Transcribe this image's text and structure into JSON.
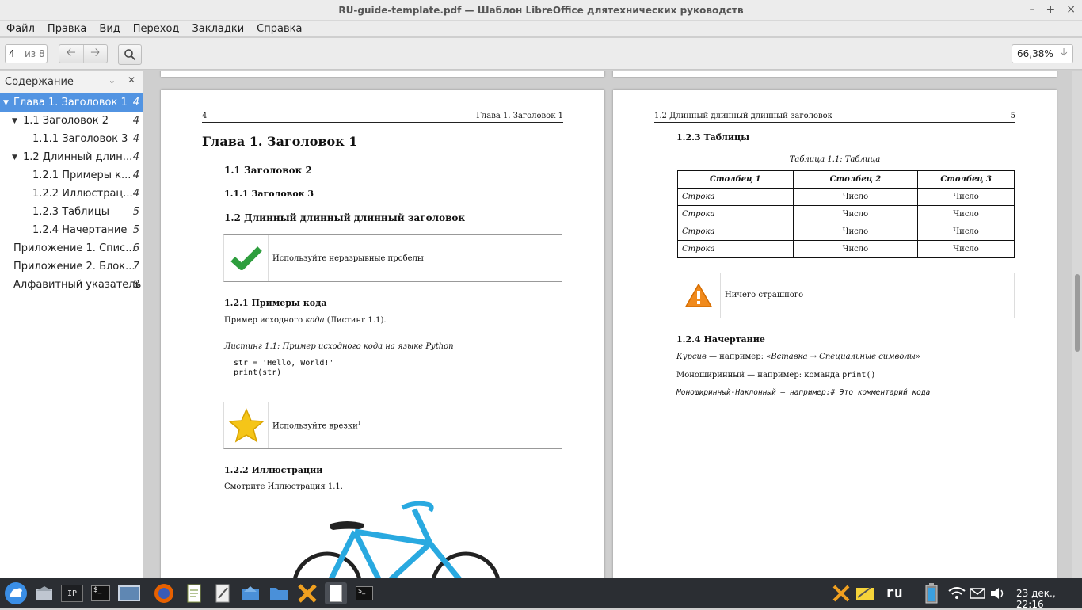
{
  "window": {
    "title": "RU-guide-template.pdf — Шаблон LibreOffice длятехнических руководств",
    "minimize": "–",
    "maximize": "+",
    "close": "×"
  },
  "menu": [
    "Файл",
    "Правка",
    "Вид",
    "Переход",
    "Закладки",
    "Справка"
  ],
  "toolbar": {
    "page_number": "4",
    "page_of": "из 8",
    "zoom": "66,38%"
  },
  "sidebar": {
    "title": "Содержание",
    "items": [
      {
        "label": "Глава 1.  Заголовок 1",
        "page": "4"
      },
      {
        "label": "1.1  Заголовок 2",
        "page": "4"
      },
      {
        "label": "1.1.1  Заголовок 3",
        "page": "4"
      },
      {
        "label": "1.2  Длинный длин...",
        "page": "4"
      },
      {
        "label": "1.2.1  Примеры к...",
        "page": "4"
      },
      {
        "label": "1.2.2  Иллюстрац...",
        "page": "4"
      },
      {
        "label": "1.2.3  Таблицы",
        "page": "5"
      },
      {
        "label": "1.2.4  Начертание",
        "page": "5"
      },
      {
        "label": "Приложение 1.  Спис...",
        "page": "6"
      },
      {
        "label": "Приложение 2.  Блок...",
        "page": "7"
      },
      {
        "label": "Алфавитный указатель",
        "page": "8"
      }
    ]
  },
  "page4": {
    "header_left": "4",
    "header_right": "Глава 1. Заголовок 1",
    "chapter": "Глава 1. Заголовок 1",
    "h_1_1": "1.1 Заголовок 2",
    "h_1_1_1": "1.1.1 Заголовок 3",
    "h_1_2": "1.2 Длинный длинный длинный заголовок",
    "note1": "Используйте неразрывные пробелы",
    "h_1_2_1": "1.2.1 Примеры кода",
    "para_code_a": "Пример исходного ",
    "para_code_b": "кода",
    "para_code_c": " (Листинг 1.1).",
    "listing_caption": "Листинг 1.1: Пример исходного кода на языке Python",
    "code_line1": "str = 'Hello, World!'",
    "code_line2": "print(str)",
    "note2": "Используйте врезки",
    "note2_sup": "1",
    "h_1_2_2": "1.2.2 Иллюстрации",
    "para_illus": "Смотрите Иллюстрация 1.1."
  },
  "page5": {
    "header_left": "1.2 Длинный длинный длинный заголовок",
    "header_right": "5",
    "h_1_2_3": "1.2.3 Таблицы",
    "table_caption": "Таблица 1.1: Таблица",
    "table": {
      "headers": [
        "Столбец 1",
        "Столбец 2",
        "Столбец 3"
      ],
      "rows": [
        [
          "Строка",
          "Число",
          "Число"
        ],
        [
          "Строка",
          "Число",
          "Число"
        ],
        [
          "Строка",
          "Число",
          "Число"
        ],
        [
          "Строка",
          "Число",
          "Число"
        ]
      ]
    },
    "note3": "Ничего страшного",
    "h_1_2_4": "1.2.4 Начертание",
    "italic_label": "Курсив",
    "italic_mid": " — например: «",
    "italic_example": "Вставка → Специальные символы",
    "italic_end": "»",
    "mono_label": "Моноширинный — например: команда ",
    "mono_example": "print()",
    "monoit_line": "Моноширинный-Наклонный — например:# Это комментарий кода"
  },
  "taskbar": {
    "lang": "ru",
    "datetime": "23 дек., 22:16"
  },
  "colors": {
    "selection": "#5294e2",
    "check": "#2e9e3e",
    "star": "#f5c518",
    "warning": "#f08a1c",
    "bike": "#29a9e0"
  }
}
